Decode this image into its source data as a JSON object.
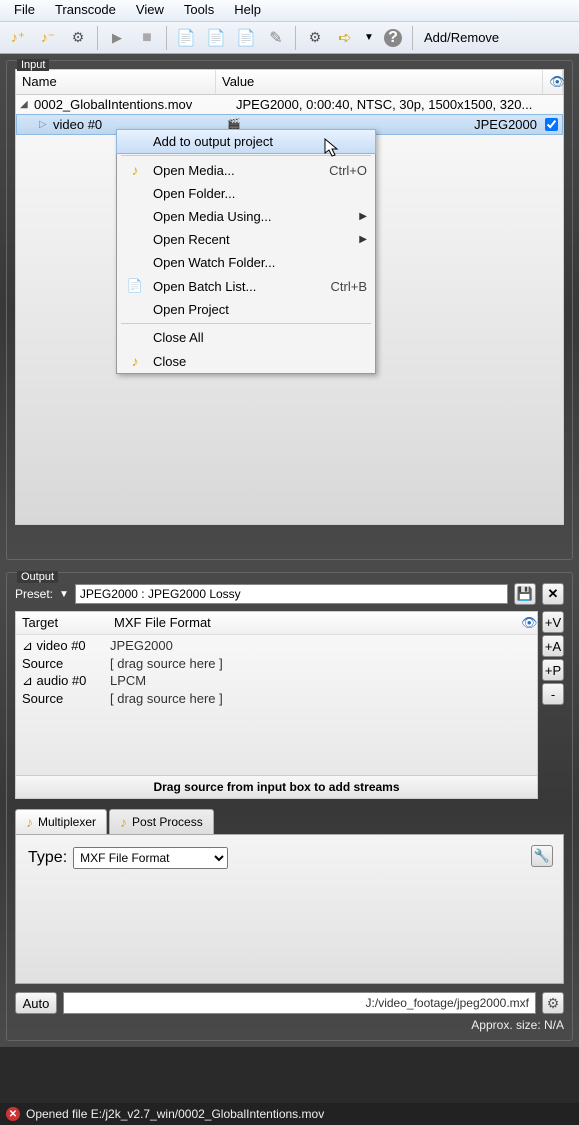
{
  "menubar": [
    "File",
    "Transcode",
    "View",
    "Tools",
    "Help"
  ],
  "toolbar": {
    "add_remove": "Add/Remove "
  },
  "input": {
    "title": "Input",
    "header": {
      "name": "Name",
      "value": "Value"
    },
    "file_row": {
      "name": "0002_GlobalIntentions.mov",
      "value": "JPEG2000, 0:00:40, NTSC, 30p, 1500x1500, 320..."
    },
    "video_row": {
      "name": "video #0",
      "value": "JPEG2000"
    }
  },
  "context_menu": {
    "items": [
      {
        "label": "Add to output project",
        "hl": true
      },
      {
        "label": "Open Media...",
        "shortcut": "Ctrl+O",
        "icon": "note"
      },
      {
        "label": "Open Folder..."
      },
      {
        "label": "Open Media Using...",
        "sub": true
      },
      {
        "label": "Open Recent",
        "sub": true
      },
      {
        "label": "Open Watch Folder..."
      },
      {
        "label": "Open Batch List...",
        "shortcut": "Ctrl+B",
        "icon": "doc"
      },
      {
        "label": "Open Project"
      },
      {
        "label": "Close All"
      },
      {
        "label": "Close",
        "icon": "note"
      }
    ]
  },
  "output": {
    "title": "Output",
    "preset_label": "Preset:",
    "preset_value": "JPEG2000 : JPEG2000 Lossy",
    "header": {
      "target": "Target",
      "value": "MXF File Format"
    },
    "rows": [
      {
        "c1": "⊿ video #0",
        "c2": "JPEG2000"
      },
      {
        "c1": "   Source",
        "c2": "[ drag source here ]"
      },
      {
        "c1": "⊿ audio #0",
        "c2": "LPCM"
      },
      {
        "c1": "   Source",
        "c2": "[ drag source here ]"
      }
    ],
    "side_btns": [
      "+V",
      "+A",
      "+P",
      "-"
    ],
    "drag_hint": "Drag source from input box to add streams",
    "tabs": {
      "multiplexer": "Multiplexer",
      "post_process": "Post Process"
    },
    "type_label": "Type:",
    "type_value": "MXF File Format",
    "auto": "Auto",
    "path": "J:/video_footage/jpeg2000.mxf",
    "approx": "Approx. size: N/A"
  },
  "status": "Opened file E:/j2k_v2.7_win/0002_GlobalIntentions.mov"
}
